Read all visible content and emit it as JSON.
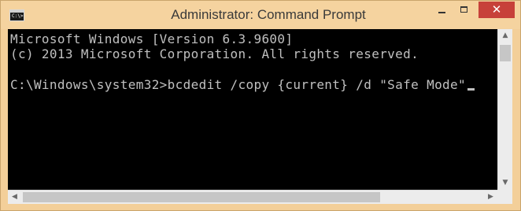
{
  "window": {
    "title": "Administrator: Command Prompt",
    "icon": "cmd-icon",
    "icon_text": "C:\\>"
  },
  "controls": {
    "minimize_icon": "minimize-icon",
    "maximize_icon": "maximize-icon",
    "close_icon": "close-icon",
    "close_glyph": "✕"
  },
  "console": {
    "lines": [
      "Microsoft Windows [Version 6.3.9600]",
      "(c) 2013 Microsoft Corporation. All rights reserved.",
      "",
      "C:\\Windows\\system32>bcdedit /copy {current} /d \"Safe Mode\""
    ],
    "background": "#000000",
    "foreground": "#c0c0c0"
  },
  "scrollbars": {
    "up_arrow": "▲",
    "down_arrow": "▼",
    "left_arrow": "◀",
    "right_arrow": "▶"
  },
  "colors": {
    "titlebar": "#f5d39f",
    "close_button": "#c7413a"
  }
}
